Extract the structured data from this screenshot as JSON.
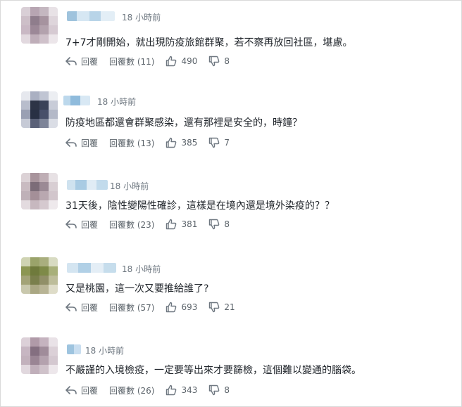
{
  "ui": {
    "reply_label": "回覆",
    "colors": {
      "text": "#1d2228",
      "muted": "#6e7780",
      "accent": "#5b636a"
    }
  },
  "comments": [
    {
      "time": "18 小時前",
      "text": "7+7才剛開始，就出現防疫旅館群聚，若不察再放回社區，堪慮。",
      "replies": "回覆數 (11)",
      "likes": "490",
      "dislikes": "8"
    },
    {
      "time": "18 小時前",
      "text": "防疫地區都還會群聚感染，還有那裡是安全的，時鐘？",
      "replies": "回覆數 (13)",
      "likes": "385",
      "dislikes": "7"
    },
    {
      "time": "18 小時前",
      "text": "31天後，陰性變陽性確診，這樣是在境內還是境外染疫的？？",
      "replies": "回覆數 (23)",
      "likes": "381",
      "dislikes": "8"
    },
    {
      "time": "18 小時前",
      "text": "又是桃園，這一次又要推給誰了?",
      "replies": "回覆數 (57)",
      "likes": "693",
      "dislikes": "21"
    },
    {
      "time": "18 小時前",
      "text": "不嚴謹的入境檢疫，一定要等出來才要篩檢，這個難以變通的腦袋。",
      "replies": "回覆數 (26)",
      "likes": "343",
      "dislikes": "8"
    }
  ]
}
